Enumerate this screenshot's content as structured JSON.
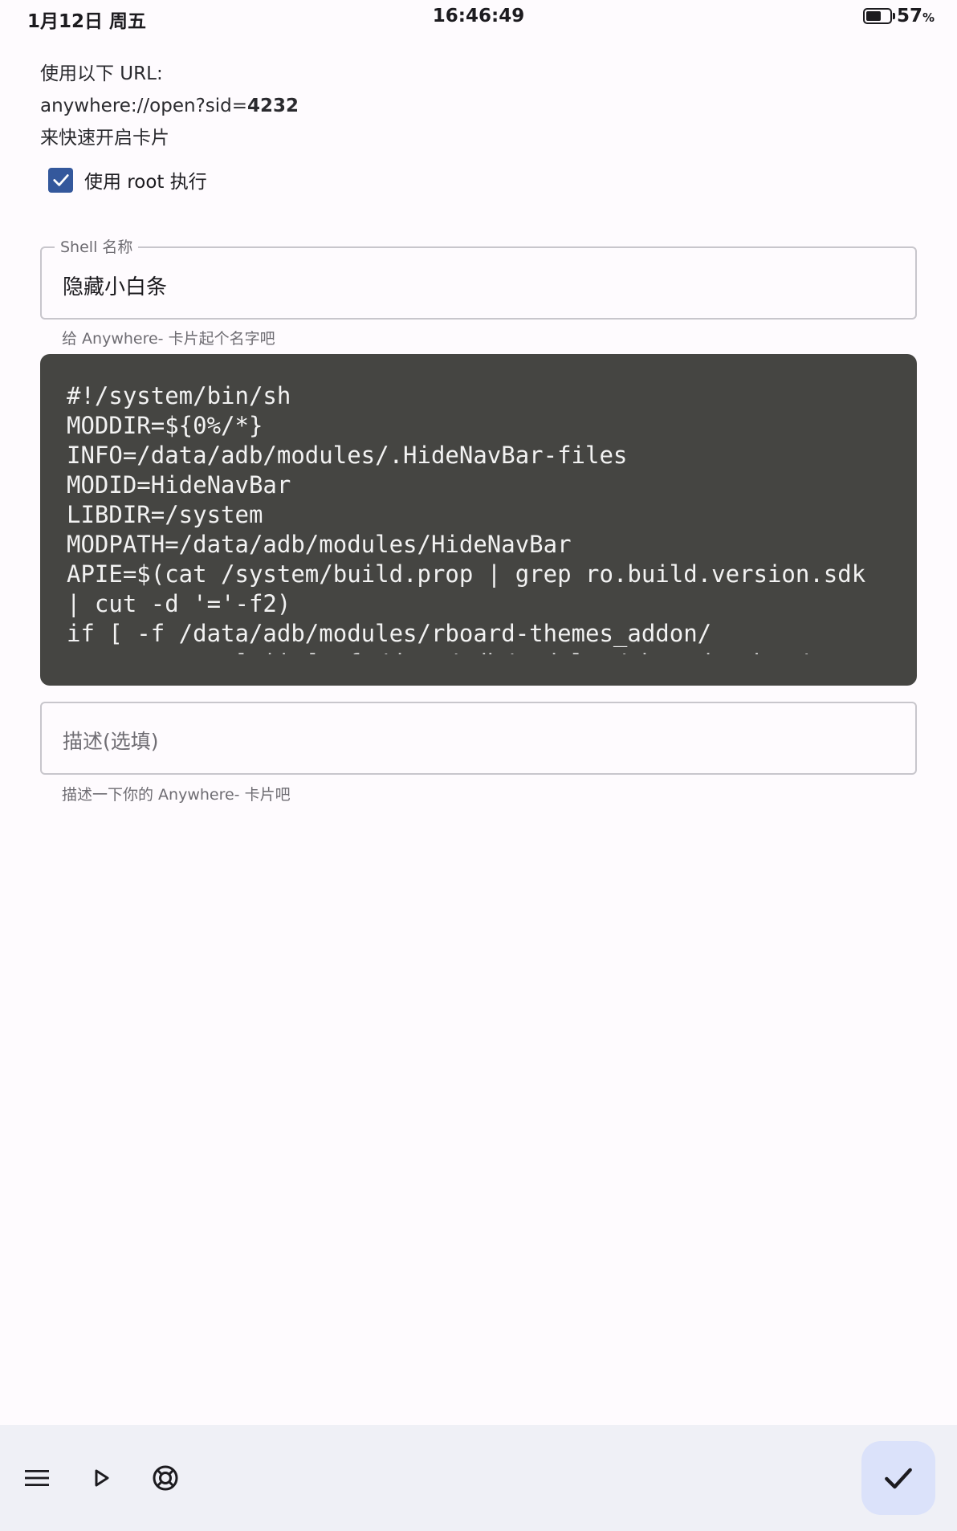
{
  "status_bar": {
    "date": "1月12日 周五",
    "time": "16:46:49",
    "battery_percent": "57",
    "battery_unit": "%"
  },
  "url_info": {
    "line1": "使用以下 URL:",
    "url_prefix": "anywhere://open?sid=",
    "sid": "4232",
    "line3": "来快速开启卡片"
  },
  "root_option": {
    "label": "使用 root 执行",
    "checked": true
  },
  "shell_name": {
    "label": "Shell 名称",
    "value": "隐藏小白条",
    "helper": "给 Anywhere- 卡片起个名字吧"
  },
  "code": {
    "lines": [
      "#!/system/bin/sh",
      "MODDIR=${0%/*}",
      "INFO=/data/adb/modules/.HideNavBar-files",
      "MODID=HideNavBar",
      "LIBDIR=/system",
      "MODPATH=/data/adb/modules/HideNavBar",
      "APIE=$(cat /system/build.prop | grep ro.build.version.sdk",
      "| cut -d '='-f2)",
      "if [ -f /data/adb/modules/rboard-themes_addon/",
      "system.prop ] || [ -f /data/adb/modules/gboardnavbar/"
    ]
  },
  "description": {
    "placeholder": "描述(选填)",
    "helper": "描述一下你的 Anywhere- 卡片吧"
  },
  "bottom_bar": {
    "icons": [
      "menu-icon",
      "play-icon",
      "lifebuoy-icon"
    ],
    "fab_icon": "check-icon"
  },
  "colors": {
    "accent": "#34589c",
    "code_bg": "#454542",
    "fab_bg": "#dbe2fa",
    "bottom_bar_bg": "#eff0f6"
  }
}
